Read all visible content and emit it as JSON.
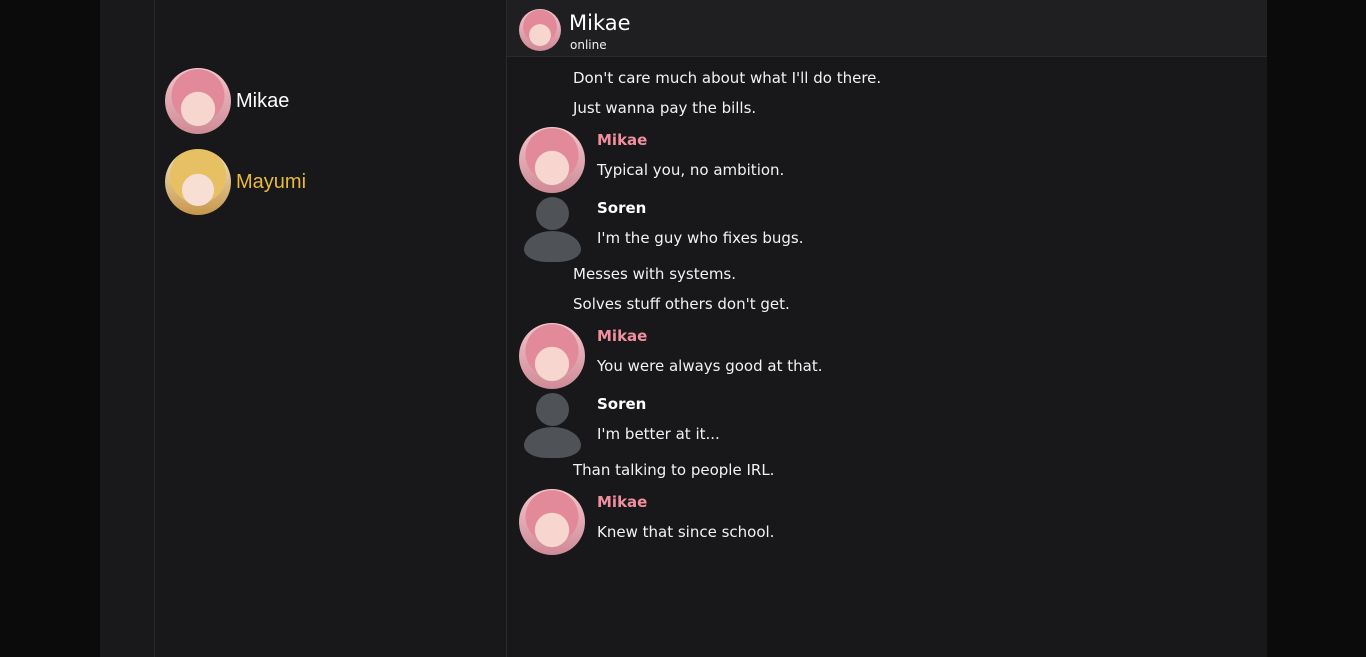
{
  "contacts": [
    {
      "name": "Mikae",
      "color": "#ffffff",
      "avatar": "mikae-avatar"
    },
    {
      "name": "Mayumi",
      "color": "#e9b93c",
      "avatar": "mayumi-avatar"
    }
  ],
  "chat_header": {
    "title": "Mikae",
    "status": "online"
  },
  "messages": [
    {
      "sender": "",
      "lines": [
        "Don't care much about what I'll do there.",
        "Just wanna pay the bills."
      ]
    },
    {
      "sender": "Mikae",
      "lines": [
        "Typical you, no ambition."
      ]
    },
    {
      "sender": "Soren",
      "lines": [
        "I'm the guy who fixes bugs.",
        "Messes with systems.",
        "Solves stuff others don't get."
      ]
    },
    {
      "sender": "Mikae",
      "lines": [
        "You were always good at that."
      ]
    },
    {
      "sender": "Soren",
      "lines": [
        "I'm better at it...",
        "Than talking to people IRL."
      ]
    },
    {
      "sender": "Mikae",
      "lines": [
        "Knew that since school."
      ]
    }
  ],
  "colors": {
    "mikae_name": "#f08f9e",
    "mayumi_name": "#e9b93c",
    "background": "#18181a"
  }
}
